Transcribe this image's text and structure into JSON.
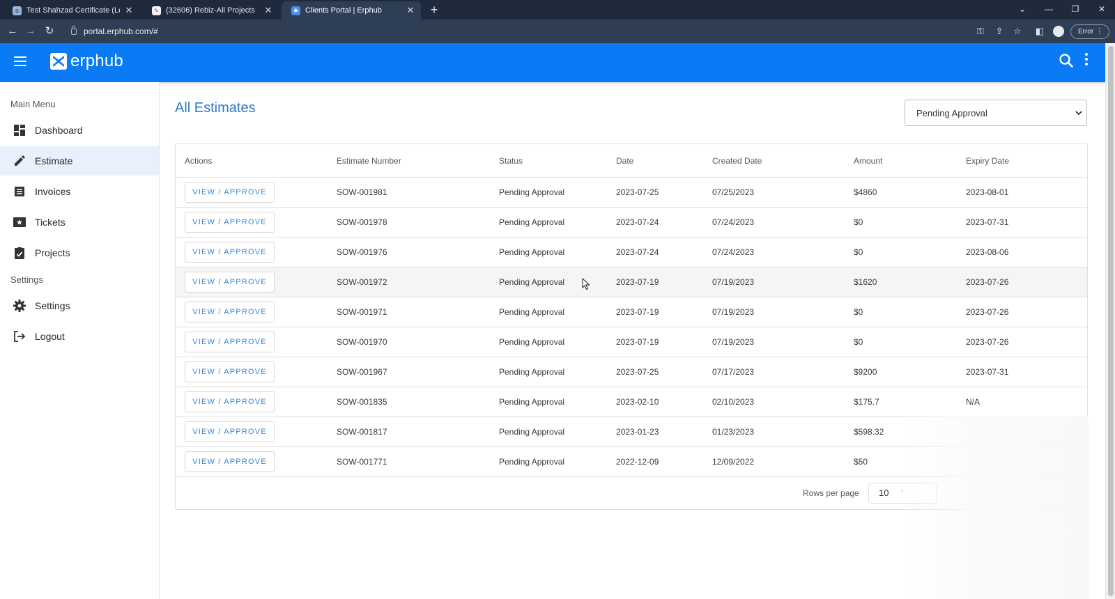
{
  "browser": {
    "tabs": [
      {
        "title": "Test Shahzad Certificate (Legal C",
        "active": false
      },
      {
        "title": "(32606) Rebiz-All Projects",
        "active": false
      },
      {
        "title": "Clients Portal | Erphub",
        "active": true
      }
    ],
    "url": "portal.erphub.com/#",
    "profile_status": "Error"
  },
  "app": {
    "logo_text": "erphub",
    "brand_color": "#0a7bf5"
  },
  "sidebar": {
    "main_menu_label": "Main Menu",
    "items": [
      {
        "label": "Dashboard",
        "icon": "dashboard-icon"
      },
      {
        "label": "Estimate",
        "icon": "pencil-icon",
        "active": true
      },
      {
        "label": "Invoices",
        "icon": "invoice-icon"
      },
      {
        "label": "Tickets",
        "icon": "ticket-icon"
      },
      {
        "label": "Projects",
        "icon": "projects-icon"
      }
    ],
    "settings_label": "Settings",
    "settings_items": [
      {
        "label": "Settings",
        "icon": "gear-icon"
      },
      {
        "label": "Logout",
        "icon": "logout-icon"
      }
    ]
  },
  "main": {
    "title": "All Estimates",
    "filter_value": "Pending Approval",
    "table": {
      "headers": [
        "Actions",
        "Estimate Number",
        "Status",
        "Date",
        "Created Date",
        "Amount",
        "Expiry Date"
      ],
      "action_label": "VIEW / APPROVE",
      "rows": [
        {
          "number": "SOW-001981",
          "status": "Pending Approval",
          "date": "2023-07-25",
          "created": "07/25/2023",
          "amount": "$4860",
          "expiry": "2023-08-01"
        },
        {
          "number": "SOW-001978",
          "status": "Pending Approval",
          "date": "2023-07-24",
          "created": "07/24/2023",
          "amount": "$0",
          "expiry": "2023-07-31"
        },
        {
          "number": "SOW-001976",
          "status": "Pending Approval",
          "date": "2023-07-24",
          "created": "07/24/2023",
          "amount": "$0",
          "expiry": "2023-08-06"
        },
        {
          "number": "SOW-001972",
          "status": "Pending Approval",
          "date": "2023-07-19",
          "created": "07/19/2023",
          "amount": "$1620",
          "expiry": "2023-07-26"
        },
        {
          "number": "SOW-001971",
          "status": "Pending Approval",
          "date": "2023-07-19",
          "created": "07/19/2023",
          "amount": "$0",
          "expiry": "2023-07-26"
        },
        {
          "number": "SOW-001970",
          "status": "Pending Approval",
          "date": "2023-07-19",
          "created": "07/19/2023",
          "amount": "$0",
          "expiry": "2023-07-26"
        },
        {
          "number": "SOW-001967",
          "status": "Pending Approval",
          "date": "2023-07-25",
          "created": "07/17/2023",
          "amount": "$9200",
          "expiry": "2023-07-31"
        },
        {
          "number": "SOW-001835",
          "status": "Pending Approval",
          "date": "2023-02-10",
          "created": "02/10/2023",
          "amount": "$175.7",
          "expiry": "N/A"
        },
        {
          "number": "SOW-001817",
          "status": "Pending Approval",
          "date": "2023-01-23",
          "created": "01/23/2023",
          "amount": "$598.32",
          "expiry": ""
        },
        {
          "number": "SOW-001771",
          "status": "Pending Approval",
          "date": "2022-12-09",
          "created": "12/09/2022",
          "amount": "$50",
          "expiry": ""
        }
      ]
    },
    "rows_per_page_label": "Rows per page",
    "rows_per_page_value": "10"
  }
}
